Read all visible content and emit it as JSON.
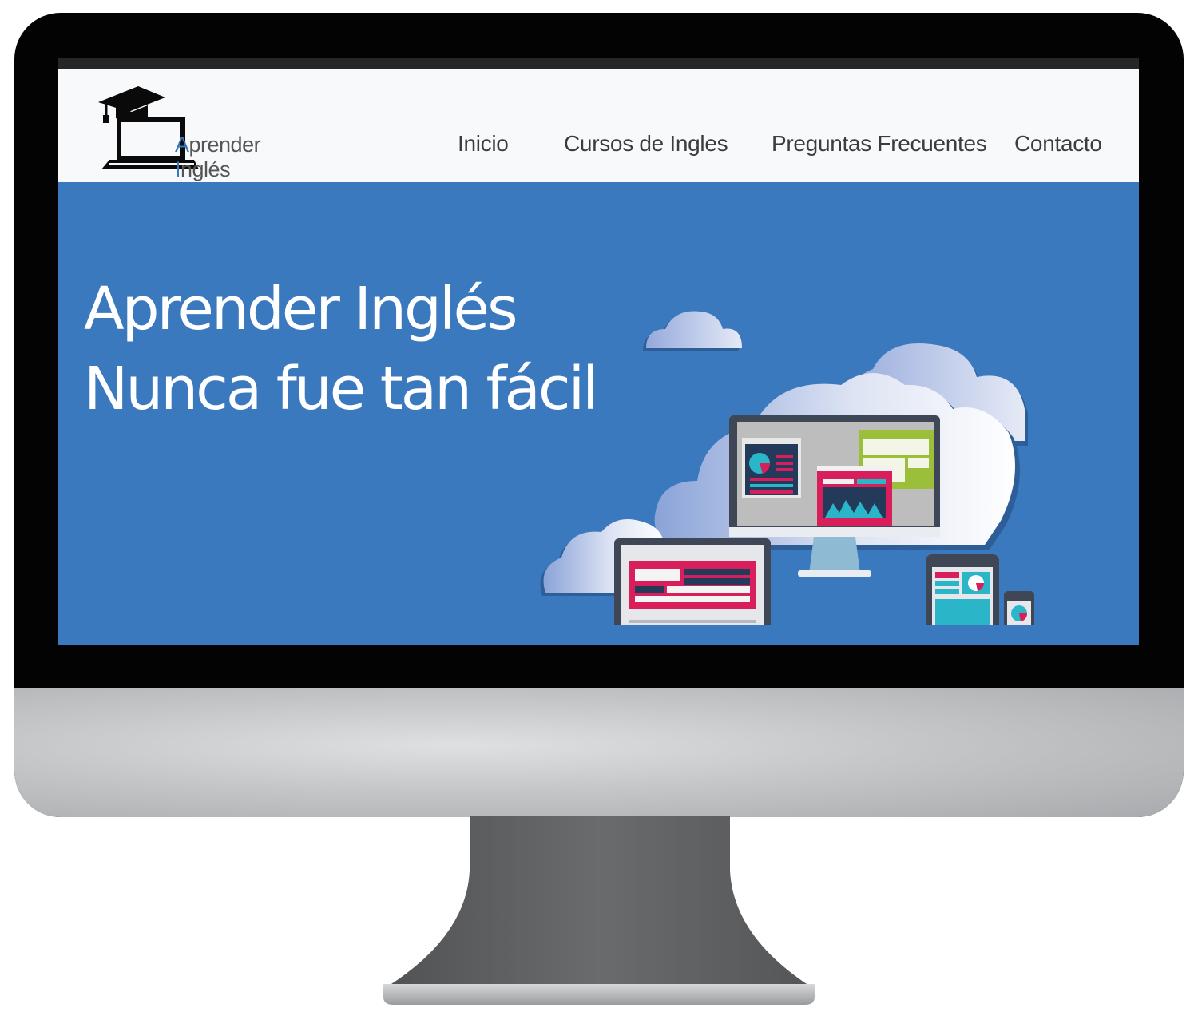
{
  "logo": {
    "first_initial": "A",
    "first_rest": "prender ",
    "second_initial": "I",
    "second_rest": "nglés"
  },
  "nav": {
    "items": [
      {
        "label": "Inicio"
      },
      {
        "label": "Cursos de Ingles"
      },
      {
        "label": "Preguntas Frecuentes"
      },
      {
        "label": "Contacto"
      }
    ]
  },
  "hero": {
    "line1": "Aprender Inglés",
    "line2": "Nunca fue tan fácil"
  },
  "colors": {
    "hero_bg": "#3a79bd",
    "header_bg": "#f8f9fa",
    "accent": "#3a79bd",
    "crimson": "#d81e5b",
    "teal": "#2bb5c8",
    "green": "#9bbf3b"
  }
}
